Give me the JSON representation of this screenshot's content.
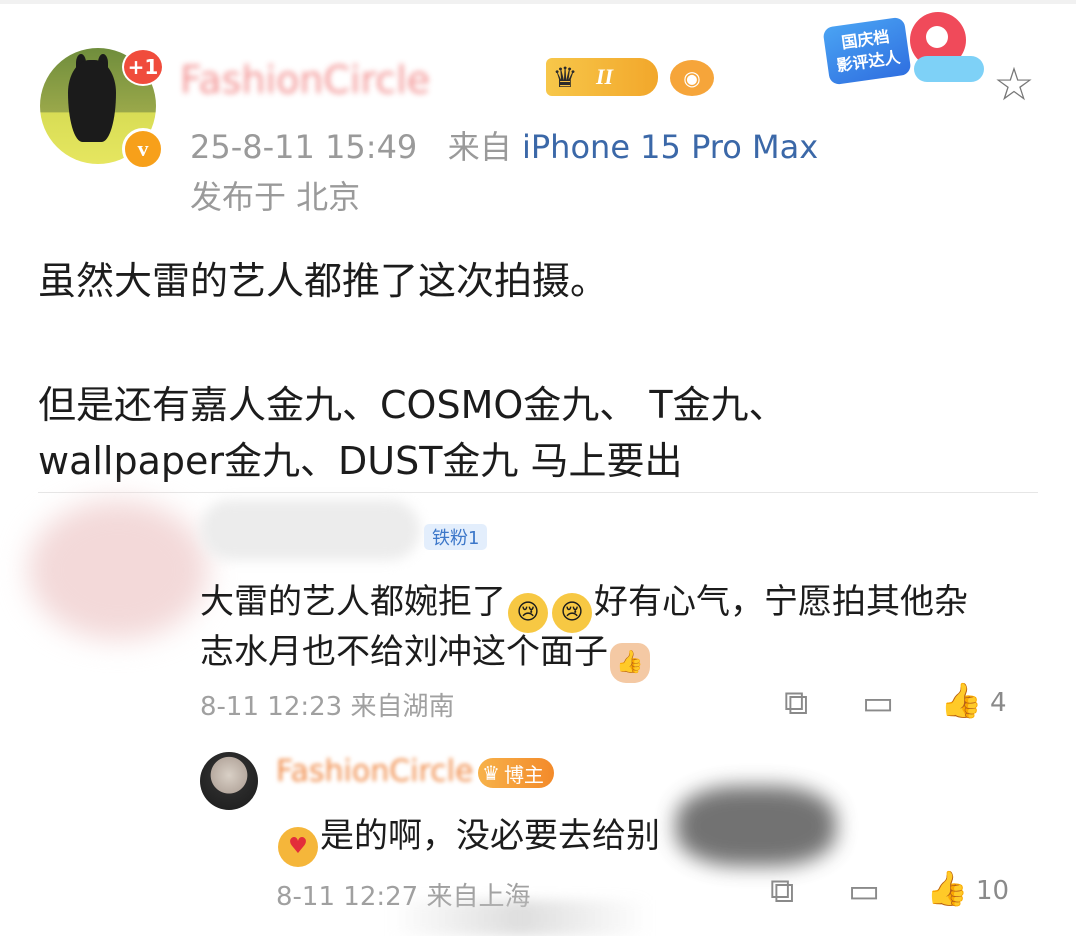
{
  "post": {
    "plus_badge": "+1",
    "verified_badge": "v",
    "username": "FashionCircle",
    "vip_level": "II",
    "time": "25-8-11 15:49",
    "from_label": "来自",
    "device": "iPhone 15 Pro Max",
    "location": "发布于 北京",
    "event_badge_line1": "国庆档",
    "event_badge_line2": "影评达人",
    "body_lines": [
      "虽然大雷的艺人都推了这次拍摄。",
      "但是还有嘉人金九、COSMO金九、 T金九、",
      "wallpaper金九、DUST金九 马上要出"
    ]
  },
  "comment": {
    "fan_badge": "铁粉1",
    "text_part1": "大雷的艺人都婉拒了",
    "text_part2": "好有心气，宁愿拍其他杂",
    "text_line2": "志水月也不给刘冲这个面子",
    "meta": "8-11 12:23 来自湖南",
    "likes": "4"
  },
  "reply": {
    "name": "FashionCircle",
    "host_badge": "博主",
    "text": "是的啊，没必要去给别",
    "meta": "8-11 12:27 来自上海",
    "likes": "10"
  },
  "icons": {
    "star": "star-icon",
    "edit": "share-icon",
    "reply": "comment-icon",
    "like": "thumbs-up-icon"
  },
  "colors": {
    "link_blue": "#3b68a8",
    "meta_gray": "#9a9a9a",
    "fan_badge_bg": "#e3eefc",
    "host_badge_orange": "#f38a2a",
    "plus_red": "#f04c3c"
  }
}
